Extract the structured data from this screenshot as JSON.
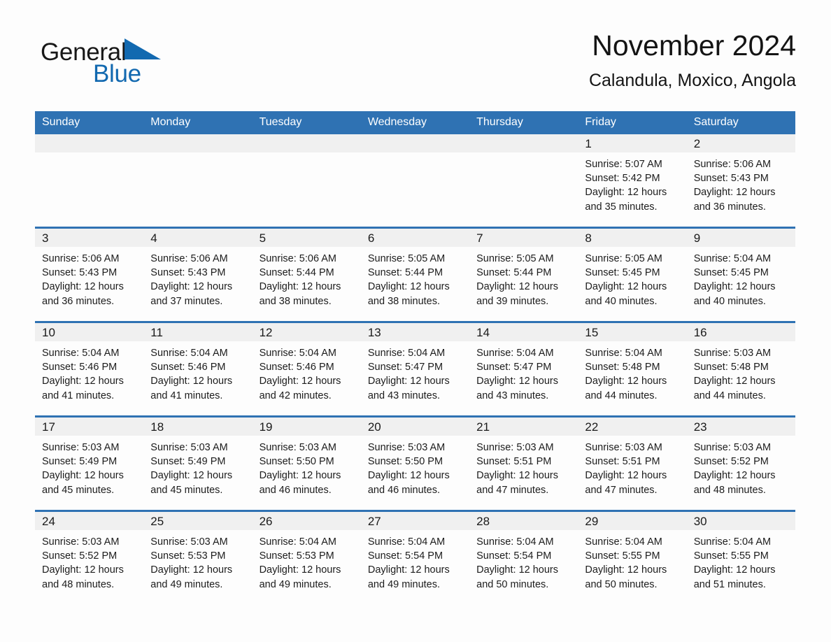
{
  "brand": {
    "word1": "General",
    "word2": "Blue",
    "triangle_color": "#1269b0",
    "text_color": "#181818"
  },
  "header": {
    "title": "November 2024",
    "subtitle": "Calandula, Moxico, Angola"
  },
  "colors": {
    "header_bar": "#2f72b3",
    "daynum_strip": "#f0f0f0",
    "row_divider": "#2f72b3",
    "page_background": "#fdfdfd",
    "text": "#1a1a1a"
  },
  "weekday_headers": [
    "Sunday",
    "Monday",
    "Tuesday",
    "Wednesday",
    "Thursday",
    "Friday",
    "Saturday"
  ],
  "labels": {
    "sunrise_prefix": "Sunrise:",
    "sunset_prefix": "Sunset:",
    "daylight_prefix": "Daylight:"
  },
  "weeks": [
    [
      {
        "day": "",
        "sunrise": "",
        "sunset": "",
        "daylight_line1": "",
        "daylight_line2": ""
      },
      {
        "day": "",
        "sunrise": "",
        "sunset": "",
        "daylight_line1": "",
        "daylight_line2": ""
      },
      {
        "day": "",
        "sunrise": "",
        "sunset": "",
        "daylight_line1": "",
        "daylight_line2": ""
      },
      {
        "day": "",
        "sunrise": "",
        "sunset": "",
        "daylight_line1": "",
        "daylight_line2": ""
      },
      {
        "day": "",
        "sunrise": "",
        "sunset": "",
        "daylight_line1": "",
        "daylight_line2": ""
      },
      {
        "day": "1",
        "sunrise": "Sunrise: 5:07 AM",
        "sunset": "Sunset: 5:42 PM",
        "daylight_line1": "Daylight: 12 hours",
        "daylight_line2": "and 35 minutes."
      },
      {
        "day": "2",
        "sunrise": "Sunrise: 5:06 AM",
        "sunset": "Sunset: 5:43 PM",
        "daylight_line1": "Daylight: 12 hours",
        "daylight_line2": "and 36 minutes."
      }
    ],
    [
      {
        "day": "3",
        "sunrise": "Sunrise: 5:06 AM",
        "sunset": "Sunset: 5:43 PM",
        "daylight_line1": "Daylight: 12 hours",
        "daylight_line2": "and 36 minutes."
      },
      {
        "day": "4",
        "sunrise": "Sunrise: 5:06 AM",
        "sunset": "Sunset: 5:43 PM",
        "daylight_line1": "Daylight: 12 hours",
        "daylight_line2": "and 37 minutes."
      },
      {
        "day": "5",
        "sunrise": "Sunrise: 5:06 AM",
        "sunset": "Sunset: 5:44 PM",
        "daylight_line1": "Daylight: 12 hours",
        "daylight_line2": "and 38 minutes."
      },
      {
        "day": "6",
        "sunrise": "Sunrise: 5:05 AM",
        "sunset": "Sunset: 5:44 PM",
        "daylight_line1": "Daylight: 12 hours",
        "daylight_line2": "and 38 minutes."
      },
      {
        "day": "7",
        "sunrise": "Sunrise: 5:05 AM",
        "sunset": "Sunset: 5:44 PM",
        "daylight_line1": "Daylight: 12 hours",
        "daylight_line2": "and 39 minutes."
      },
      {
        "day": "8",
        "sunrise": "Sunrise: 5:05 AM",
        "sunset": "Sunset: 5:45 PM",
        "daylight_line1": "Daylight: 12 hours",
        "daylight_line2": "and 40 minutes."
      },
      {
        "day": "9",
        "sunrise": "Sunrise: 5:04 AM",
        "sunset": "Sunset: 5:45 PM",
        "daylight_line1": "Daylight: 12 hours",
        "daylight_line2": "and 40 minutes."
      }
    ],
    [
      {
        "day": "10",
        "sunrise": "Sunrise: 5:04 AM",
        "sunset": "Sunset: 5:46 PM",
        "daylight_line1": "Daylight: 12 hours",
        "daylight_line2": "and 41 minutes."
      },
      {
        "day": "11",
        "sunrise": "Sunrise: 5:04 AM",
        "sunset": "Sunset: 5:46 PM",
        "daylight_line1": "Daylight: 12 hours",
        "daylight_line2": "and 41 minutes."
      },
      {
        "day": "12",
        "sunrise": "Sunrise: 5:04 AM",
        "sunset": "Sunset: 5:46 PM",
        "daylight_line1": "Daylight: 12 hours",
        "daylight_line2": "and 42 minutes."
      },
      {
        "day": "13",
        "sunrise": "Sunrise: 5:04 AM",
        "sunset": "Sunset: 5:47 PM",
        "daylight_line1": "Daylight: 12 hours",
        "daylight_line2": "and 43 minutes."
      },
      {
        "day": "14",
        "sunrise": "Sunrise: 5:04 AM",
        "sunset": "Sunset: 5:47 PM",
        "daylight_line1": "Daylight: 12 hours",
        "daylight_line2": "and 43 minutes."
      },
      {
        "day": "15",
        "sunrise": "Sunrise: 5:04 AM",
        "sunset": "Sunset: 5:48 PM",
        "daylight_line1": "Daylight: 12 hours",
        "daylight_line2": "and 44 minutes."
      },
      {
        "day": "16",
        "sunrise": "Sunrise: 5:03 AM",
        "sunset": "Sunset: 5:48 PM",
        "daylight_line1": "Daylight: 12 hours",
        "daylight_line2": "and 44 minutes."
      }
    ],
    [
      {
        "day": "17",
        "sunrise": "Sunrise: 5:03 AM",
        "sunset": "Sunset: 5:49 PM",
        "daylight_line1": "Daylight: 12 hours",
        "daylight_line2": "and 45 minutes."
      },
      {
        "day": "18",
        "sunrise": "Sunrise: 5:03 AM",
        "sunset": "Sunset: 5:49 PM",
        "daylight_line1": "Daylight: 12 hours",
        "daylight_line2": "and 45 minutes."
      },
      {
        "day": "19",
        "sunrise": "Sunrise: 5:03 AM",
        "sunset": "Sunset: 5:50 PM",
        "daylight_line1": "Daylight: 12 hours",
        "daylight_line2": "and 46 minutes."
      },
      {
        "day": "20",
        "sunrise": "Sunrise: 5:03 AM",
        "sunset": "Sunset: 5:50 PM",
        "daylight_line1": "Daylight: 12 hours",
        "daylight_line2": "and 46 minutes."
      },
      {
        "day": "21",
        "sunrise": "Sunrise: 5:03 AM",
        "sunset": "Sunset: 5:51 PM",
        "daylight_line1": "Daylight: 12 hours",
        "daylight_line2": "and 47 minutes."
      },
      {
        "day": "22",
        "sunrise": "Sunrise: 5:03 AM",
        "sunset": "Sunset: 5:51 PM",
        "daylight_line1": "Daylight: 12 hours",
        "daylight_line2": "and 47 minutes."
      },
      {
        "day": "23",
        "sunrise": "Sunrise: 5:03 AM",
        "sunset": "Sunset: 5:52 PM",
        "daylight_line1": "Daylight: 12 hours",
        "daylight_line2": "and 48 minutes."
      }
    ],
    [
      {
        "day": "24",
        "sunrise": "Sunrise: 5:03 AM",
        "sunset": "Sunset: 5:52 PM",
        "daylight_line1": "Daylight: 12 hours",
        "daylight_line2": "and 48 minutes."
      },
      {
        "day": "25",
        "sunrise": "Sunrise: 5:03 AM",
        "sunset": "Sunset: 5:53 PM",
        "daylight_line1": "Daylight: 12 hours",
        "daylight_line2": "and 49 minutes."
      },
      {
        "day": "26",
        "sunrise": "Sunrise: 5:04 AM",
        "sunset": "Sunset: 5:53 PM",
        "daylight_line1": "Daylight: 12 hours",
        "daylight_line2": "and 49 minutes."
      },
      {
        "day": "27",
        "sunrise": "Sunrise: 5:04 AM",
        "sunset": "Sunset: 5:54 PM",
        "daylight_line1": "Daylight: 12 hours",
        "daylight_line2": "and 49 minutes."
      },
      {
        "day": "28",
        "sunrise": "Sunrise: 5:04 AM",
        "sunset": "Sunset: 5:54 PM",
        "daylight_line1": "Daylight: 12 hours",
        "daylight_line2": "and 50 minutes."
      },
      {
        "day": "29",
        "sunrise": "Sunrise: 5:04 AM",
        "sunset": "Sunset: 5:55 PM",
        "daylight_line1": "Daylight: 12 hours",
        "daylight_line2": "and 50 minutes."
      },
      {
        "day": "30",
        "sunrise": "Sunrise: 5:04 AM",
        "sunset": "Sunset: 5:55 PM",
        "daylight_line1": "Daylight: 12 hours",
        "daylight_line2": "and 51 minutes."
      }
    ]
  ]
}
